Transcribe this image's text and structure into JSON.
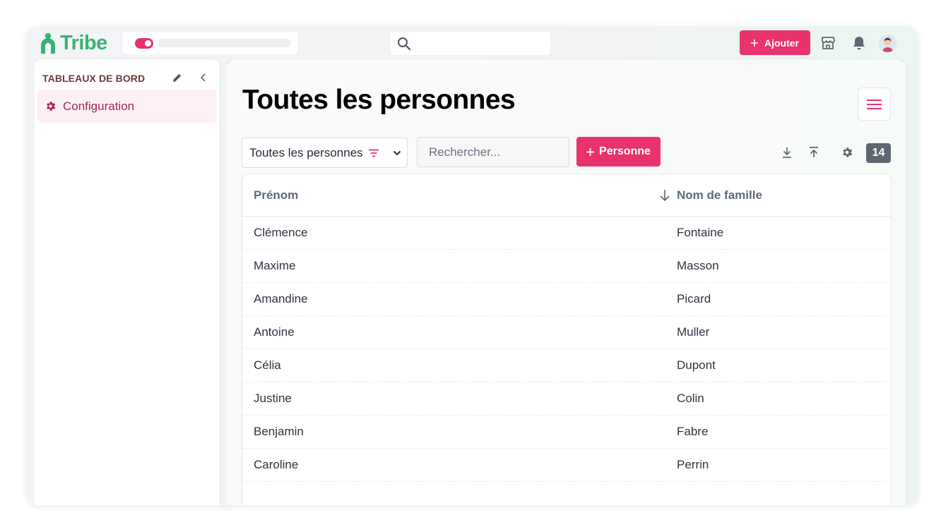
{
  "brand": {
    "name": "Tribe",
    "color": "#3bb273"
  },
  "accent_color": "#e8336d",
  "topbar": {
    "add_button_label": "Ajouter",
    "icons": [
      "search-icon",
      "store-icon",
      "bell-icon",
      "avatar"
    ]
  },
  "sidebar": {
    "title": "TABLEAUX DE BORD",
    "items": [
      {
        "label": "Configuration",
        "icon": "gear-icon",
        "active": true
      }
    ]
  },
  "main": {
    "title": "Toutes les personnes",
    "view_select": {
      "label": "Toutes les personnes"
    },
    "search": {
      "placeholder": "Rechercher..."
    },
    "add_person_label": "Personne",
    "count": "14",
    "table": {
      "columns": [
        "Prénom",
        "Nom de famille"
      ],
      "rows": [
        [
          "Clémence",
          "Fontaine"
        ],
        [
          "Maxime",
          "Masson"
        ],
        [
          "Amandine",
          "Picard"
        ],
        [
          "Antoine",
          "Muller"
        ],
        [
          "Célia",
          "Dupont"
        ],
        [
          "Justine",
          "Colin"
        ],
        [
          "Benjamin",
          "Fabre"
        ],
        [
          "Caroline",
          "Perrin"
        ]
      ]
    }
  }
}
